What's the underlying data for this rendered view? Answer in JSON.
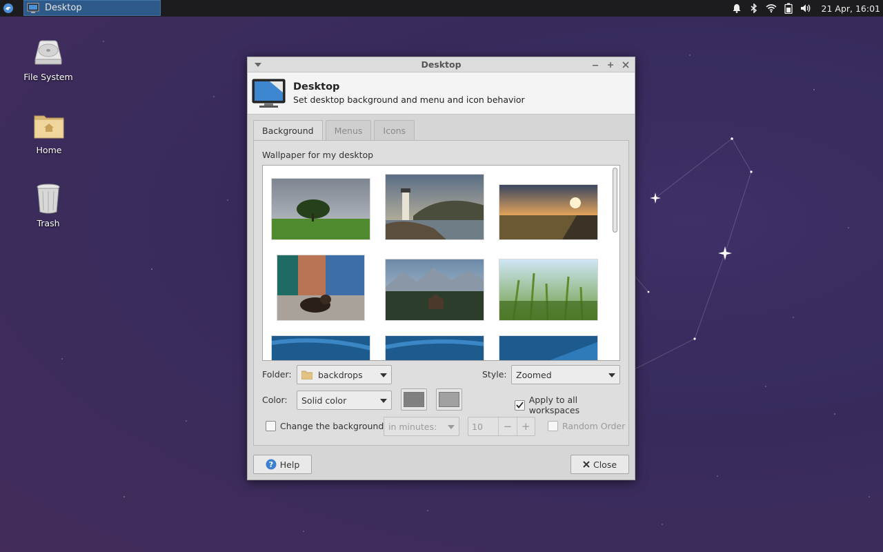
{
  "panel": {
    "task_title": "Desktop",
    "clock": "21 Apr, 16:01",
    "icons": [
      "whisker-menu-icon",
      "notification-bell-icon",
      "bluetooth-icon",
      "wifi-icon",
      "battery-icon",
      "volume-icon"
    ]
  },
  "desktop_icons": [
    {
      "label": "File System",
      "icon": "hard-drive-icon"
    },
    {
      "label": "Home",
      "icon": "home-folder-icon"
    },
    {
      "label": "Trash",
      "icon": "trash-icon"
    }
  ],
  "window": {
    "title": "Desktop",
    "header_title": "Desktop",
    "header_subtitle": "Set desktop background and menu and icon behavior",
    "tabs": [
      {
        "label": "Background",
        "active": true
      },
      {
        "label": "Menus",
        "active": false
      },
      {
        "label": "Icons",
        "active": false
      }
    ],
    "wallpaper_label": "Wallpaper for my desktop",
    "folder_label": "Folder:",
    "folder_value": "backdrops",
    "style_label": "Style:",
    "style_value": "Zoomed",
    "color_label": "Color:",
    "color_value": "Solid color",
    "color1": "#808080",
    "color2": "#a0a0a0",
    "apply_all_label": "Apply to all workspaces",
    "apply_all_checked": true,
    "change_bg_label": "Change the background",
    "change_bg_checked": false,
    "interval_value": "in minutes:",
    "interval_number": "10",
    "random_order_label": "Random Order",
    "help_label": "Help",
    "close_label": "Close"
  }
}
